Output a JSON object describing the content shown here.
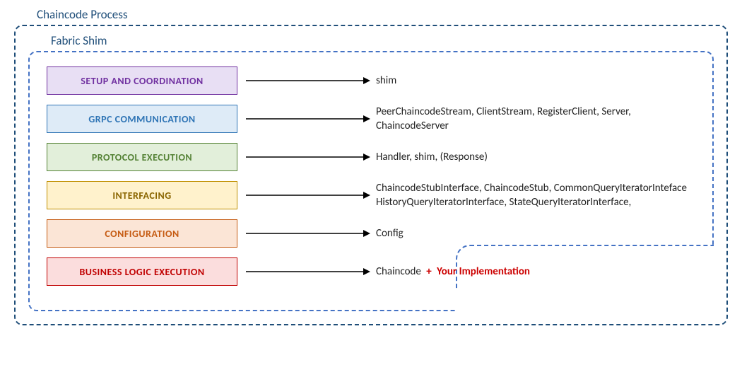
{
  "outer_title": "Chaincode Process",
  "inner_title": "Fabric Shim",
  "rows": [
    {
      "label": "SETUP AND COORDINATION",
      "desc": "shim"
    },
    {
      "label": "GRPC COMMUNICATION",
      "desc": "PeerChaincodeStream, ClientStream, RegisterClient, Server, ChaincodeServer"
    },
    {
      "label": "PROTOCOL EXECUTION",
      "desc": "Handler, shim, (Response)"
    },
    {
      "label": "INTERFACING",
      "desc": "ChaincodeStubInterface, ChaincodeStub, CommonQueryIteratorInteface HistoryQueryIteratorInterface, StateQueryIteratorInterface,"
    },
    {
      "label": "CONFIGURATION",
      "desc": "Config"
    },
    {
      "label": "BUSINESS LOGIC EXECUTION",
      "desc": "Chaincode"
    }
  ],
  "extra": {
    "plus": "+",
    "your_implementation": "Your Implementation"
  }
}
